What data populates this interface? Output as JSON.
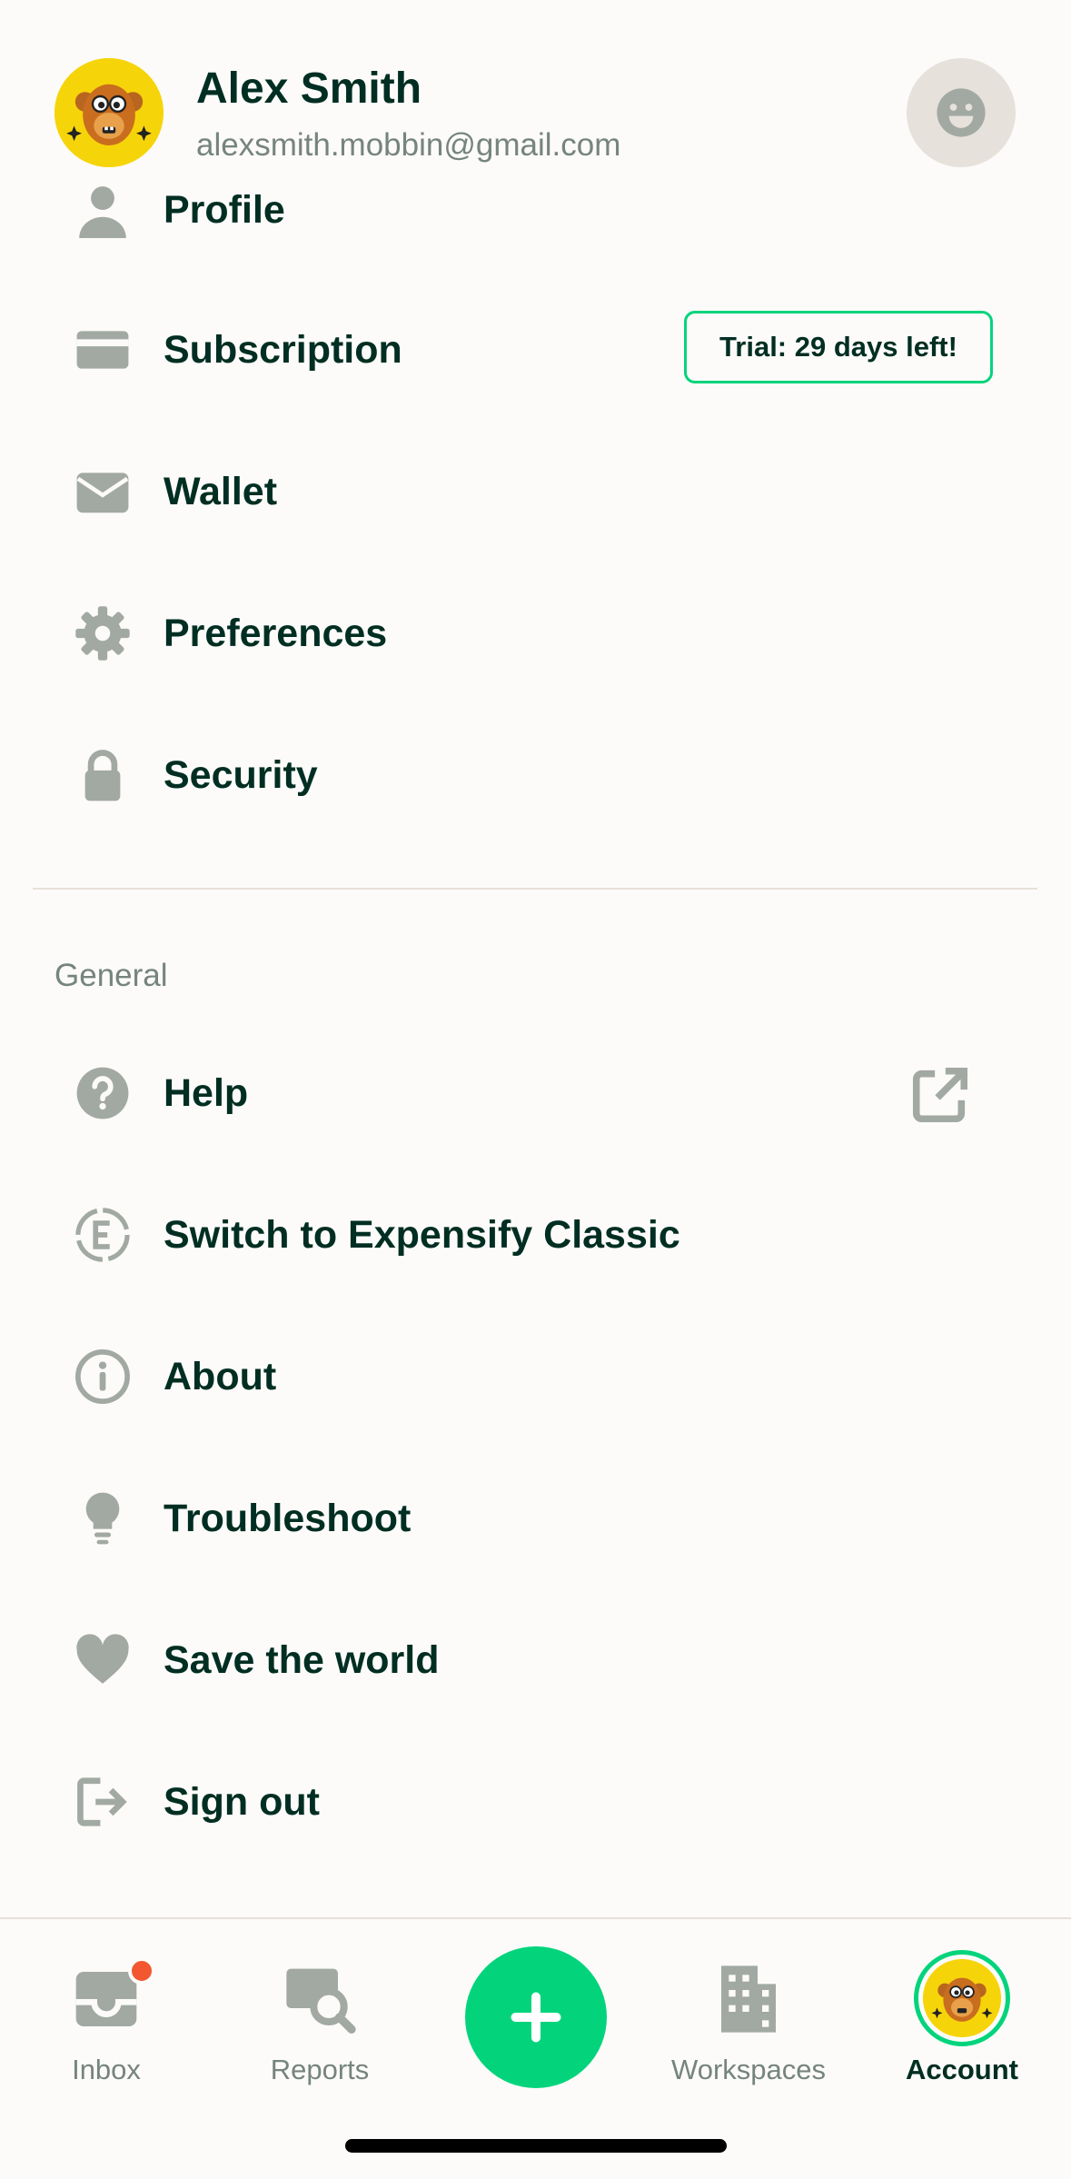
{
  "header": {
    "name": "Alex Smith",
    "email": "alexsmith.mobbin@gmail.com",
    "avatar_icon": "monkey-avatar-icon",
    "status_icon": "smiley-face-icon"
  },
  "account_items": [
    {
      "label": "Profile",
      "icon": "person-icon"
    },
    {
      "label": "Subscription",
      "icon": "credit-card-icon",
      "badge": "Trial: 29 days left!"
    },
    {
      "label": "Wallet",
      "icon": "wallet-icon"
    },
    {
      "label": "Preferences",
      "icon": "gear-icon"
    },
    {
      "label": "Security",
      "icon": "lock-icon"
    }
  ],
  "general": {
    "title": "General",
    "items": [
      {
        "label": "Help",
        "icon": "question-icon",
        "trailing_icon": "external-link-icon"
      },
      {
        "label": "Switch to Expensify Classic",
        "icon": "expensify-e-icon"
      },
      {
        "label": "About",
        "icon": "info-icon"
      },
      {
        "label": "Troubleshoot",
        "icon": "lightbulb-icon"
      },
      {
        "label": "Save the world",
        "icon": "heart-icon"
      },
      {
        "label": "Sign out",
        "icon": "sign-out-icon"
      }
    ]
  },
  "bottom_nav": {
    "items": [
      {
        "label": "Inbox",
        "icon": "inbox-icon",
        "has_badge": true
      },
      {
        "label": "Reports",
        "icon": "reports-search-icon"
      },
      {
        "label": "",
        "icon": "plus-icon"
      },
      {
        "label": "Workspaces",
        "icon": "building-icon"
      },
      {
        "label": "Account",
        "icon": "monkey-avatar-icon",
        "active": true
      }
    ]
  },
  "colors": {
    "accent": "#03d47c",
    "text": "#002e22",
    "muted": "#76847e",
    "icon_gray": "#a2a9a3",
    "badge": "#f25730",
    "avatar_bg": "#f6d40a",
    "background": "#fcfbf9"
  }
}
